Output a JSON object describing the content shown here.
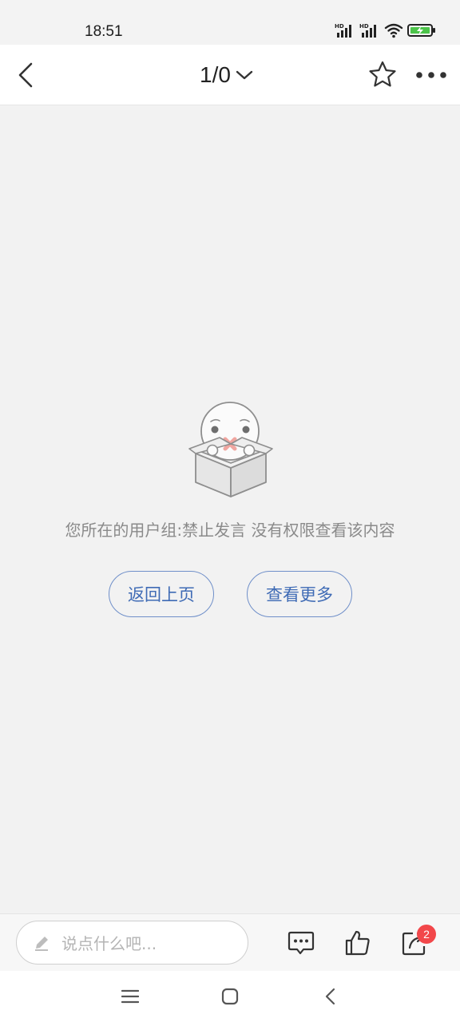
{
  "status_bar": {
    "time": "18:51",
    "icons": [
      "hd-signal-icon",
      "hd-signal-icon",
      "wifi-icon",
      "battery-charging-icon"
    ]
  },
  "header": {
    "page_indicator": "1/0",
    "icons": [
      "back-arrow-icon",
      "chevron-down-icon",
      "star-icon",
      "more-dots-icon"
    ]
  },
  "empty_state": {
    "illustration": "sad-face-in-box-icon",
    "message": "您所在的用户组:禁止发言 没有权限查看该内容",
    "back_button_label": "返回上页",
    "more_button_label": "查看更多"
  },
  "bottom_bar": {
    "input_placeholder": "说点什么吧...",
    "icons": [
      "pencil-icon",
      "comment-icon",
      "thumbs-up-icon",
      "share-icon"
    ],
    "share_badge_count": "2",
    "badge_color": "#f2474a"
  },
  "system_nav": {
    "icons": [
      "menu-icon",
      "home-icon",
      "back-icon"
    ]
  },
  "colors": {
    "accent": "#3f6bb5",
    "background": "#f2f2f2"
  }
}
